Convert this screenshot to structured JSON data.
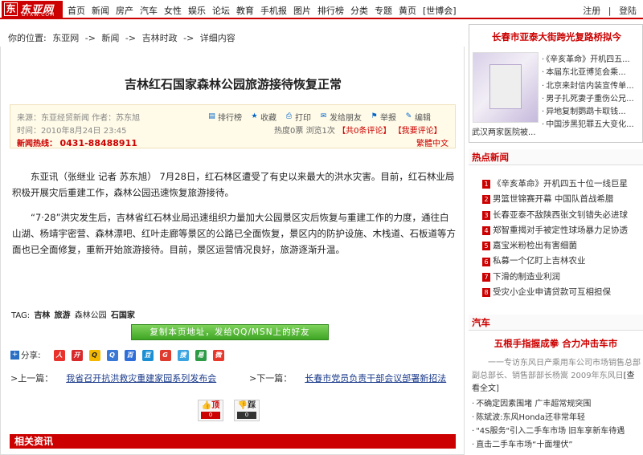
{
  "header": {
    "logo_mark": "东",
    "logo_name": "东亚网",
    "logo_sub": "DYXW.COM",
    "nav": [
      "首页",
      "新闻",
      "房产",
      "汽车",
      "女性",
      "娱乐",
      "论坛",
      "教育",
      "手机报",
      "图片",
      "排行榜",
      "分类",
      "专题",
      "黄页",
      "[世博会]"
    ],
    "register": "注册",
    "sep": "|",
    "login": "登陆"
  },
  "breadcrumb": [
    "你的位置:",
    "东亚网",
    "->",
    "新闻",
    "->",
    "吉林时政",
    "->",
    "详细内容"
  ],
  "article": {
    "title": "吉林红石国家森林公园旅游接待恢复正常",
    "source_line": "来源：东亚经贸新闻  作者：苏东旭",
    "time_line": "时间：2010年8月24日 23:45",
    "hotline_label": "新闻热线：",
    "hotline": "0431-88488911",
    "tools": [
      {
        "icon": "bar-chart-icon",
        "glyph": "▤",
        "label": "排行榜"
      },
      {
        "icon": "star-icon",
        "glyph": "★",
        "label": "收藏"
      },
      {
        "icon": "print-icon",
        "glyph": "⎙",
        "label": "打印"
      },
      {
        "icon": "mail-icon",
        "glyph": "✉",
        "label": "发给朋友"
      },
      {
        "icon": "report-icon",
        "glyph": "⚑",
        "label": "举报"
      },
      {
        "icon": "edit-icon",
        "glyph": "✎",
        "label": "编辑"
      }
    ],
    "heat": "热度0票",
    "views": "浏览1次",
    "comments": "【共0条评论】",
    "my_comment": "【我要评论】",
    "traditional": "繁體中文",
    "paragraphs": [
      "东亚讯（张继业 记者 苏东旭） 7月28日，红石林区遭受了有史以来最大的洪水灾害。目前，红石林业局积极开展灾后重建工作，森林公园迅速恢复旅游接待。",
      "“7·28”洪灾发生后，吉林省红石林业局迅速组织力量加大公园景区灾后恢复与重建工作的力度，通往白山湖、杨靖宇密营、森林漂吧、红叶走廊等景区的公路已全面恢复，景区内的防护设施、木栈道、石板道等方面也已全面修复，重新开始旅游接待。目前，景区运营情况良好，旅游逐渐升温。"
    ],
    "tag_label": "TAG:",
    "tags": [
      "吉林",
      "旅游",
      "森林公园",
      "石国家"
    ],
    "copy_button": "复制本页地址，发给QQ/MSN上的好友",
    "share_label": "分享:",
    "prev_label": ">上一篇：",
    "prev_title": "我省召开抗洪救灾重建家园系列发布会",
    "next_label": ">下一篇：",
    "next_title": "长春市党员负责干部会议部署新招法",
    "vote_up": "顶",
    "vote_up_count": "0",
    "vote_down": "踩",
    "vote_down_count": "0",
    "related_title": "相关资讯"
  },
  "sidebar": {
    "promo_title": "长春市亚泰大街跨光复路桥拟今",
    "promo_caption": "武汉两家医院被...",
    "promo_items": [
      "《辛亥革命》开机四五...",
      "本届东北亚博览会乘...",
      "北京来封信内装宣传单...",
      "男子扎死妻子重伤公兄...",
      "异地复制鹦鹉卡取钱...",
      "中国涉黑犯罪五大变化..."
    ],
    "hot_title": "热点新闻",
    "hot_items": [
      {
        "n": "1",
        "t": "《辛亥革命》开机四五十位一线巨星"
      },
      {
        "n": "2",
        "t": "男篮世锦赛开幕 中国队首战希腊"
      },
      {
        "n": "3",
        "t": "长春亚泰不敌陕西张文钊错失必进球"
      },
      {
        "n": "4",
        "t": "郑智重揭对手被定性球场暴力足协透"
      },
      {
        "n": "5",
        "t": "嘉宝米粉检出有害细菌"
      },
      {
        "n": "6",
        "t": "私募一个亿盯上吉林农业"
      },
      {
        "n": "7",
        "t": "下滑的制造业利润"
      },
      {
        "n": "8",
        "t": "受灾小企业申请贷款可互相担保"
      }
    ],
    "car_title": "汽车",
    "car_head": "五根手指握成拳  合力冲击车市",
    "car_desc_a": "一一专访东风日产乘用车公司市场销售总部副总部长、销售部部长杨嵩  2009年东风日",
    "car_desc_b": "[查看全文]",
    "car_items": [
      "不确定因素围堵 广丰超常规突围",
      "陈斌波:东风Honda还非常年轻",
      "\"4S服务\"引入二手车市场 旧车享新车待遇",
      "直击二手车市场“十面埋伏”"
    ]
  },
  "colors": {
    "brand": "#cc0000",
    "link": "#1a3a8a",
    "button_green": "#3ea524"
  }
}
